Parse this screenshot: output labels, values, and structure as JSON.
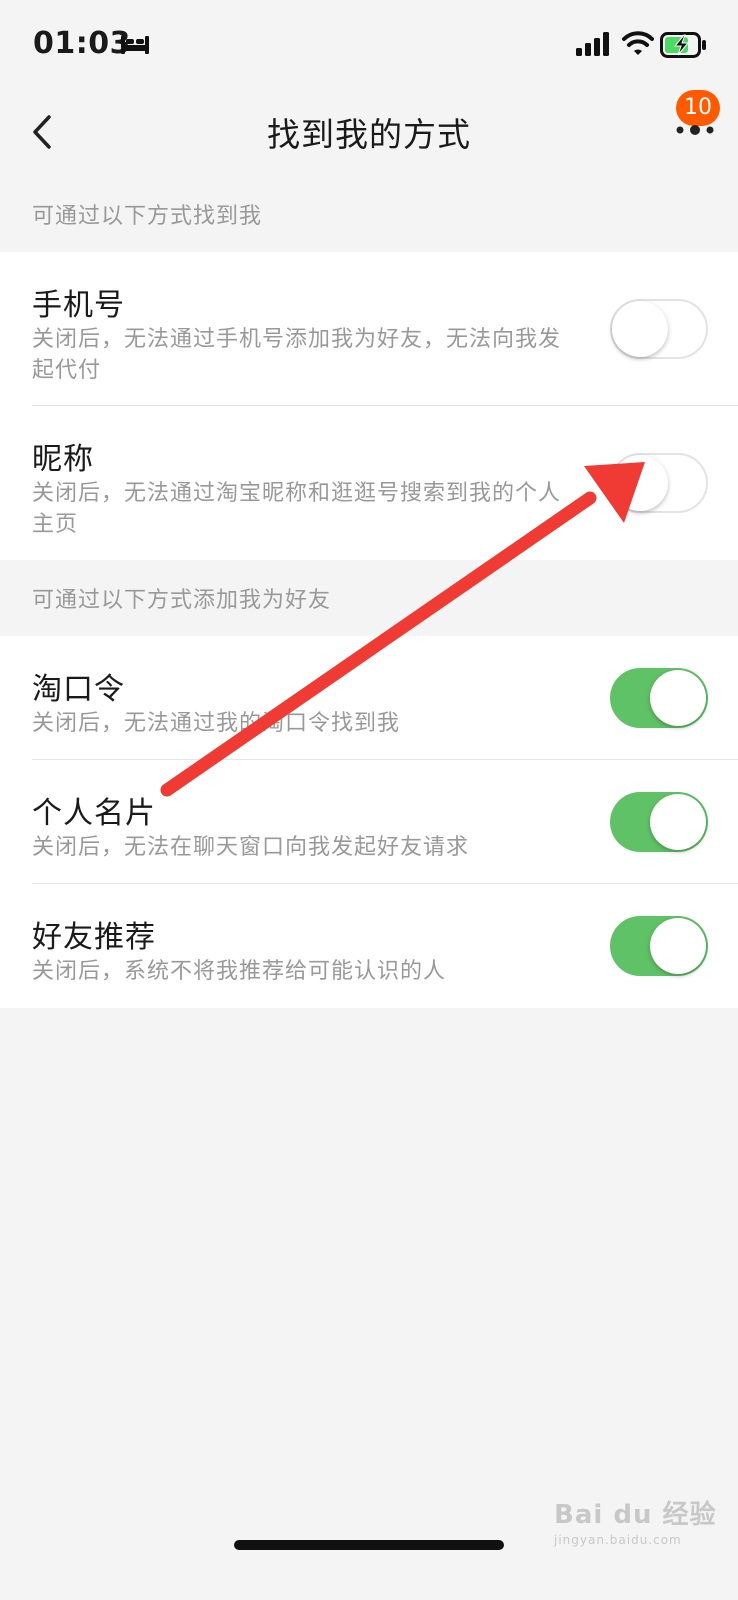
{
  "status_bar": {
    "time": "01:03"
  },
  "nav": {
    "title": "找到我的方式",
    "badge_count": "10"
  },
  "sections": [
    {
      "header": "可通过以下方式找到我",
      "rows": [
        {
          "title": "手机号",
          "desc": "关闭后，无法通过手机号添加我为好友，无法向我发起代付",
          "enabled": false
        },
        {
          "title": "昵称",
          "desc": "关闭后，无法通过淘宝昵称和逛逛号搜索到我的个人主页",
          "enabled": false
        }
      ]
    },
    {
      "header": "可通过以下方式添加我为好友",
      "rows": [
        {
          "title": "淘口令",
          "desc": "关闭后，无法通过我的淘口令找到我",
          "enabled": true
        },
        {
          "title": "个人名片",
          "desc": "关闭后，无法在聊天窗口向我发起好友请求",
          "enabled": true
        },
        {
          "title": "好友推荐",
          "desc": "关闭后，系统不将我推荐给可能认识的人",
          "enabled": true
        }
      ]
    }
  ],
  "colors": {
    "toggle_on": "#5fc266",
    "badge": "#ff5a00",
    "annotation_arrow": "#f03a34"
  },
  "watermark": {
    "brand": "Bai du 经验",
    "sub": "jingyan.baidu.com"
  }
}
